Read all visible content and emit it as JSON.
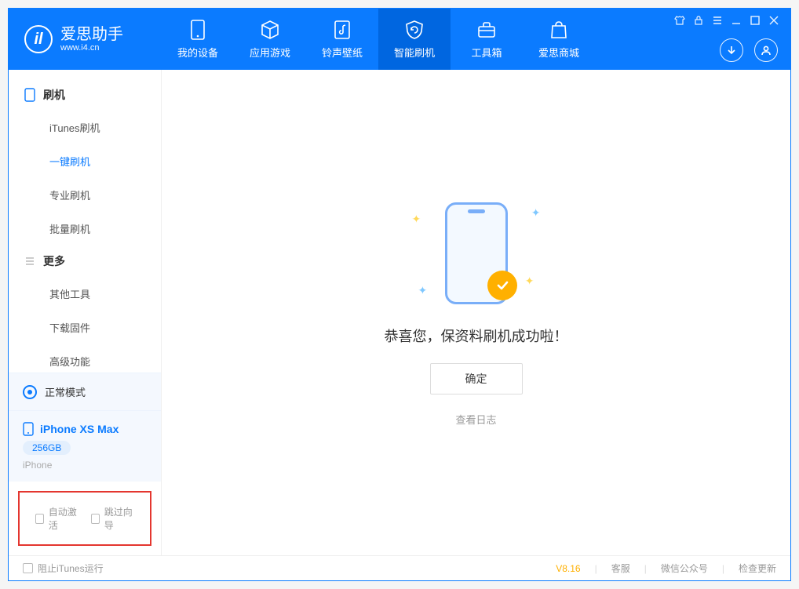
{
  "app": {
    "title": "爱思助手",
    "subtitle": "www.i4.cn"
  },
  "nav": [
    {
      "label": "我的设备",
      "icon": "device"
    },
    {
      "label": "应用游戏",
      "icon": "cube"
    },
    {
      "label": "铃声壁纸",
      "icon": "music"
    },
    {
      "label": "智能刷机",
      "icon": "refresh",
      "active": true
    },
    {
      "label": "工具箱",
      "icon": "toolbox"
    },
    {
      "label": "爱思商城",
      "icon": "bag"
    }
  ],
  "sidebar": {
    "group1": {
      "title": "刷机",
      "items": [
        "iTunes刷机",
        "一键刷机",
        "专业刷机",
        "批量刷机"
      ],
      "active_index": 1
    },
    "group2": {
      "title": "更多",
      "items": [
        "其他工具",
        "下载固件",
        "高级功能"
      ]
    },
    "status": "正常模式",
    "device": {
      "name": "iPhone XS Max",
      "capacity": "256GB",
      "type": "iPhone"
    },
    "checks": {
      "auto_activate": "自动激活",
      "skip_guide": "跳过向导"
    }
  },
  "main": {
    "message": "恭喜您，保资料刷机成功啦！",
    "ok": "确定",
    "view_log": "查看日志"
  },
  "footer": {
    "block_itunes": "阻止iTunes运行",
    "version": "V8.16",
    "links": [
      "客服",
      "微信公众号",
      "检查更新"
    ]
  }
}
